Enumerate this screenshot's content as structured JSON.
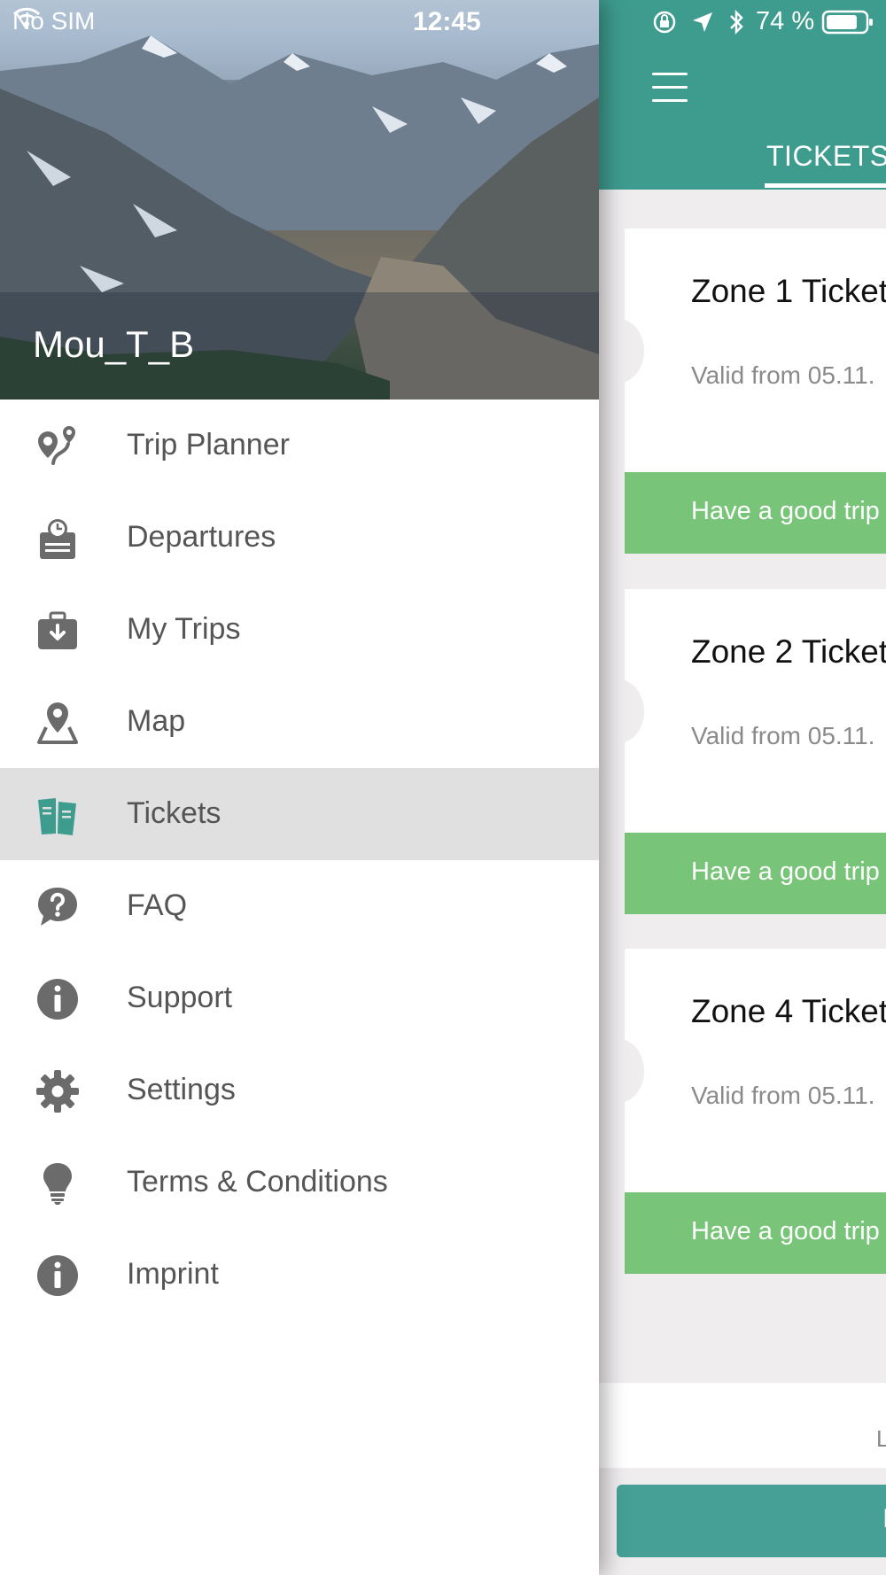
{
  "status_bar": {
    "carrier": "No SIM",
    "time": "12:45",
    "battery": "74 %"
  },
  "drawer": {
    "username": "Mou_T_B",
    "menu": [
      {
        "label": "Trip Planner",
        "icon": "route-pin-icon",
        "active": false
      },
      {
        "label": "Departures",
        "icon": "clock-board-icon",
        "active": false
      },
      {
        "label": "My Trips",
        "icon": "briefcase-download-icon",
        "active": false
      },
      {
        "label": "Map",
        "icon": "map-pin-icon",
        "active": false
      },
      {
        "label": "Tickets",
        "icon": "tickets-icon",
        "active": true
      },
      {
        "label": "FAQ",
        "icon": "question-bubble-icon",
        "active": false
      },
      {
        "label": "Support",
        "icon": "info-icon",
        "active": false
      },
      {
        "label": "Settings",
        "icon": "gear-icon",
        "active": false
      },
      {
        "label": "Terms & Conditions",
        "icon": "lightbulb-icon",
        "active": false
      },
      {
        "label": "Imprint",
        "icon": "info-icon",
        "active": false
      }
    ]
  },
  "app": {
    "tab": "TICKETS",
    "tickets": [
      {
        "title": "Zone 1 Ticket",
        "valid": "Valid from 05.11.",
        "footer": "Have a good trip"
      },
      {
        "title": "Zone 2 Ticket",
        "valid": "Valid from 05.11.",
        "footer": "Have a good trip"
      },
      {
        "title": "Zone 4 Ticket",
        "valid": "Valid from 05.11.",
        "footer": "Have a good trip"
      }
    ],
    "bottom_letter": "L",
    "bottom_button_letter": "I"
  },
  "colors": {
    "primary": "#3e9c8f",
    "ticket_footer": "#78c478",
    "active_row": "#e0e0e0",
    "background": "#efedee"
  }
}
